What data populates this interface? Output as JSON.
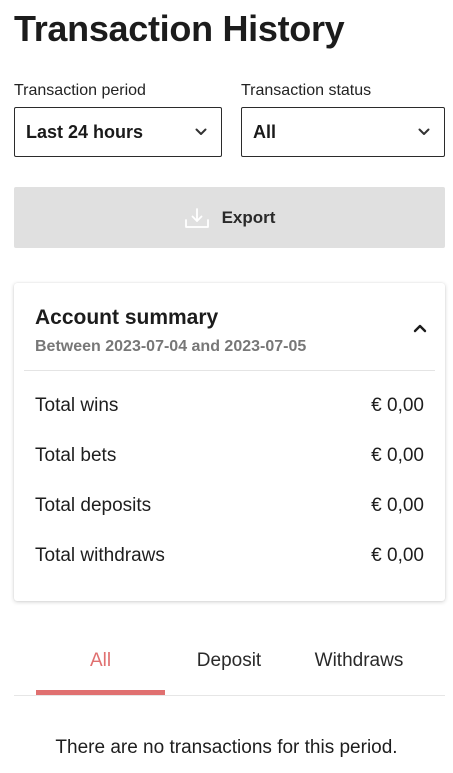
{
  "page": {
    "title": "Transaction History"
  },
  "filters": {
    "period": {
      "label": "Transaction period",
      "value": "Last 24 hours"
    },
    "status": {
      "label": "Transaction status",
      "value": "All"
    }
  },
  "export": {
    "label": "Export",
    "icon": "download-icon"
  },
  "summary": {
    "title": "Account summary",
    "subtitle": "Between 2023-07-04 and 2023-07-05",
    "expanded": true,
    "rows": [
      {
        "label": "Total wins",
        "value": "€ 0,00"
      },
      {
        "label": "Total bets",
        "value": "€ 0,00"
      },
      {
        "label": "Total deposits",
        "value": "€ 0,00"
      },
      {
        "label": "Total withdraws",
        "value": "€ 0,00"
      }
    ]
  },
  "tabs": {
    "items": [
      {
        "label": "All",
        "active": true
      },
      {
        "label": "Deposit",
        "active": false
      },
      {
        "label": "Withdraws",
        "active": false
      }
    ],
    "active_color": "#e07070"
  },
  "empty_state": {
    "message": "There are no transactions for this period."
  }
}
